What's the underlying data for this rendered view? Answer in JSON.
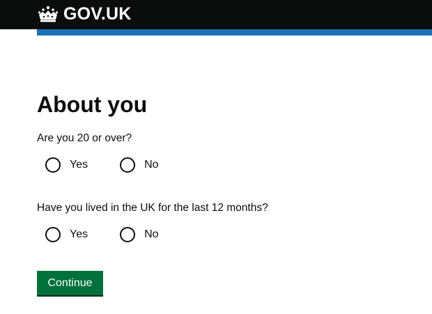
{
  "header": {
    "logo_text": "GOV.UK",
    "logo_icon": "crown-icon",
    "background_color": "#0b0c0c",
    "stripe_color": "#1d70b8"
  },
  "main": {
    "title": "About you",
    "questions": [
      {
        "label": "Are you 20 or over?",
        "options": [
          {
            "label": "Yes",
            "selected": false
          },
          {
            "label": "No",
            "selected": false
          }
        ]
      },
      {
        "label": "Have you lived in the UK for the last 12 months?",
        "options": [
          {
            "label": "Yes",
            "selected": false
          },
          {
            "label": "No",
            "selected": false
          }
        ]
      }
    ],
    "continue_label": "Continue",
    "continue_color": "#00703c"
  }
}
